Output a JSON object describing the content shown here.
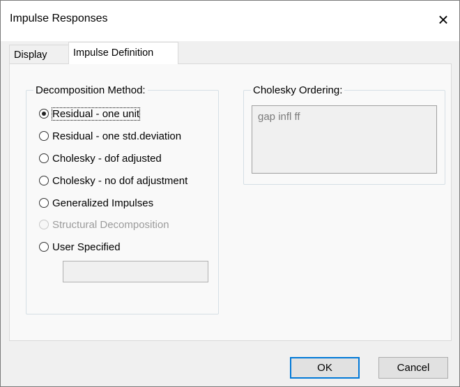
{
  "window": {
    "title": "Impulse Responses",
    "close_symbol": "×"
  },
  "tabs": [
    {
      "label": "Display",
      "active": false
    },
    {
      "label": "Impulse Definition",
      "active": true
    }
  ],
  "decomposition": {
    "legend": "Decomposition Method:",
    "options": [
      {
        "label": "Residual - one unit",
        "checked": true,
        "enabled": true
      },
      {
        "label": "Residual - one std.deviation",
        "checked": false,
        "enabled": true
      },
      {
        "label": "Cholesky - dof adjusted",
        "checked": false,
        "enabled": true
      },
      {
        "label": "Cholesky - no dof adjustment",
        "checked": false,
        "enabled": true
      },
      {
        "label": "Generalized Impulses",
        "checked": false,
        "enabled": true
      },
      {
        "label": "Structural Decomposition",
        "checked": false,
        "enabled": false
      },
      {
        "label": "User Specified",
        "checked": false,
        "enabled": true
      }
    ],
    "user_specified_value": ""
  },
  "cholesky": {
    "legend": "Cholesky Ordering:",
    "value": "gap infl ff"
  },
  "buttons": {
    "ok": "OK",
    "cancel": "Cancel"
  }
}
